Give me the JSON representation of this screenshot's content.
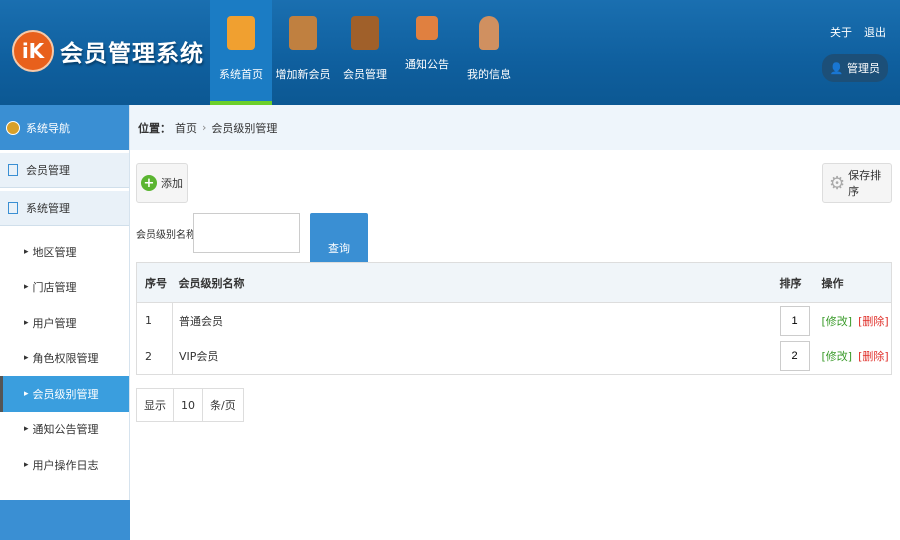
{
  "header": {
    "logo_text": "iK",
    "title": "会员管理系统",
    "nav": [
      {
        "label": "系统首页",
        "icon": "home-icon",
        "color": "#f0a030"
      },
      {
        "label": "增加新会员",
        "icon": "pencil-ruler-icon",
        "color": "#3050c0"
      },
      {
        "label": "会员管理",
        "icon": "book-icon",
        "color": "#a0602a"
      },
      {
        "label": "通知公告",
        "icon": "megaphone-icon",
        "color": "#e08040"
      },
      {
        "label": "我的信息",
        "icon": "user-icon",
        "color": "#d09060"
      }
    ],
    "about": "关于",
    "logout": "退出",
    "admin": "管理员"
  },
  "sidebar": {
    "title": "系统导航",
    "groups": [
      "会员管理",
      "系统管理"
    ],
    "items": [
      "地区管理",
      "门店管理",
      "用户管理",
      "角色权限管理",
      "会员级别管理",
      "通知公告管理",
      "用户操作日志"
    ]
  },
  "breadcrumb": {
    "label": "位置：",
    "home": "首页",
    "current": "会员级别管理"
  },
  "toolbar": {
    "add": "添加",
    "save_order": "保存排序"
  },
  "search": {
    "label": "会员级别名称",
    "value": "",
    "button": "查询"
  },
  "table": {
    "headers": [
      "序号",
      "会员级别名称",
      "排序",
      "操作"
    ],
    "rows": [
      {
        "no": "1",
        "name": "普通会员",
        "order": "1"
      },
      {
        "no": "2",
        "name": "VIP会员",
        "order": "2"
      }
    ],
    "edit": "[修改]",
    "delete": "[删除]"
  },
  "pager": {
    "show": "显示",
    "size": "10",
    "unit": "条/页"
  }
}
